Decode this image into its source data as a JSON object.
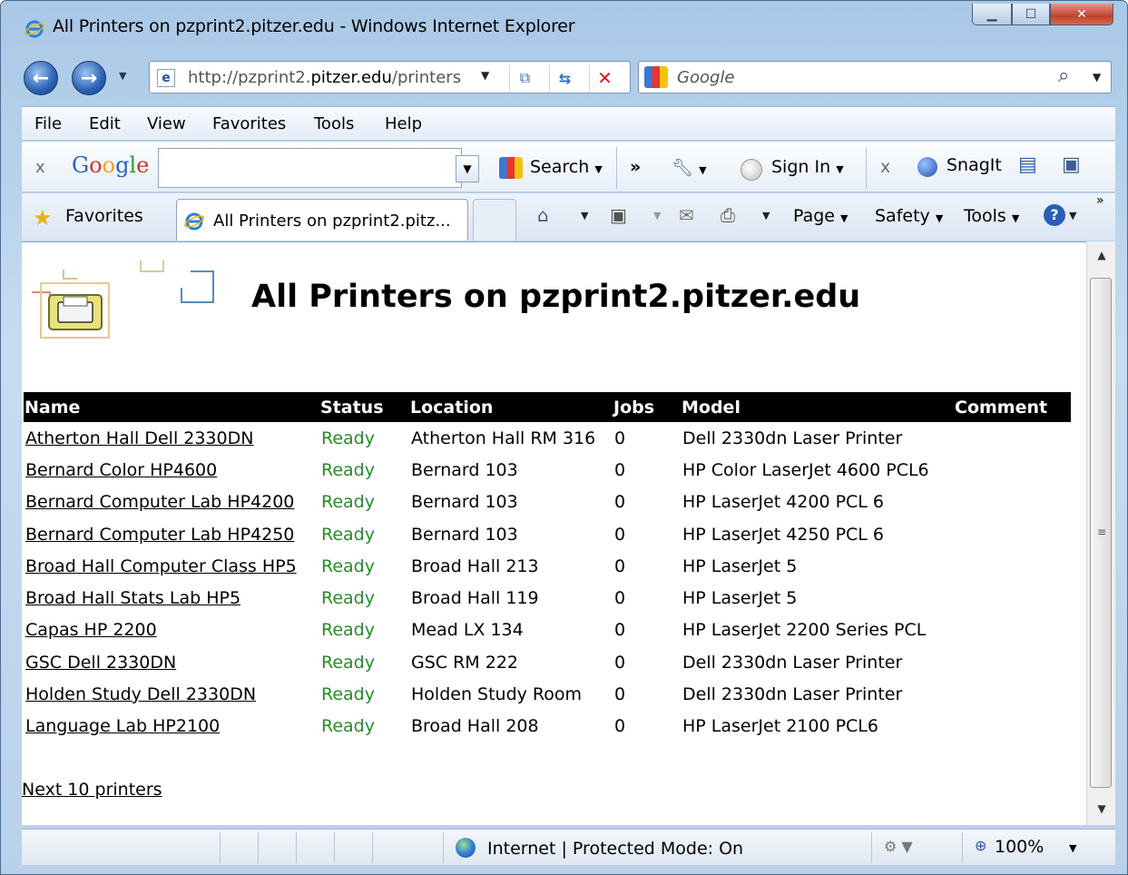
{
  "window": {
    "title": "All Printers on pzprint2.pitzer.edu - Windows Internet Explorer"
  },
  "address_bar": {
    "url_prefix": "http://pzprint2.",
    "url_domain": "pitzer.edu",
    "url_suffix": "/printers"
  },
  "search_bar": {
    "placeholder": "Google"
  },
  "menu": {
    "items": [
      "File",
      "Edit",
      "View",
      "Favorites",
      "Tools",
      "Help"
    ]
  },
  "google_toolbar": {
    "close": "x",
    "logo": "Google",
    "search_label": "Search",
    "more": "»",
    "sign_in": "Sign In",
    "close2": "x",
    "snagit": "SnagIt"
  },
  "tab_bar": {
    "favorites": "Favorites",
    "active_tab": "All Printers on pzprint2.pitz...",
    "page": "Page",
    "safety": "Safety",
    "tools": "Tools",
    "overflow": "»"
  },
  "page": {
    "title": "All Printers on pzprint2.pitzer.edu",
    "table": {
      "headers": [
        "Name",
        "Status",
        "Location",
        "Jobs",
        "Model",
        "Comment"
      ],
      "rows": [
        {
          "name": "Atherton Hall Dell 2330DN",
          "status": "Ready",
          "location": "Atherton Hall RM 316",
          "jobs": "0",
          "model": "Dell 2330dn Laser Printer",
          "comment": ""
        },
        {
          "name": "Bernard Color HP4600",
          "status": "Ready",
          "location": "Bernard 103",
          "jobs": "0",
          "model": "HP Color LaserJet 4600 PCL6",
          "comment": ""
        },
        {
          "name": "Bernard Computer Lab HP4200",
          "status": "Ready",
          "location": "Bernard 103",
          "jobs": "0",
          "model": "HP LaserJet 4200 PCL 6",
          "comment": ""
        },
        {
          "name": "Bernard Computer Lab HP4250",
          "status": "Ready",
          "location": "Bernard 103",
          "jobs": "0",
          "model": "HP LaserJet 4250 PCL 6",
          "comment": ""
        },
        {
          "name": "Broad Hall Computer Class HP5",
          "status": "Ready",
          "location": "Broad Hall 213",
          "jobs": "0",
          "model": "HP LaserJet 5",
          "comment": ""
        },
        {
          "name": "Broad Hall Stats Lab HP5",
          "status": "Ready",
          "location": "Broad Hall 119",
          "jobs": "0",
          "model": "HP LaserJet 5",
          "comment": ""
        },
        {
          "name": "Capas HP 2200",
          "status": "Ready",
          "location": "Mead LX 134",
          "jobs": "0",
          "model": "HP LaserJet 2200 Series PCL",
          "comment": ""
        },
        {
          "name": "GSC Dell 2330DN",
          "status": "Ready",
          "location": "GSC RM 222",
          "jobs": "0",
          "model": "Dell 2330dn Laser Printer",
          "comment": ""
        },
        {
          "name": "Holden Study Dell 2330DN",
          "status": "Ready",
          "location": "Holden Study Room",
          "jobs": "0",
          "model": "Dell 2330dn Laser Printer",
          "comment": ""
        },
        {
          "name": "Language Lab HP2100",
          "status": "Ready",
          "location": "Broad Hall 208",
          "jobs": "0",
          "model": "HP LaserJet 2100 PCL6",
          "comment": ""
        }
      ]
    },
    "next_link": "Next 10 printers"
  },
  "status_bar": {
    "zone": "Internet | Protected Mode: On",
    "zoom": "100%"
  },
  "colors": {
    "status_ready": "#2a8a2a",
    "table_header_bg": "#000000",
    "close_button": "#c0412b"
  }
}
